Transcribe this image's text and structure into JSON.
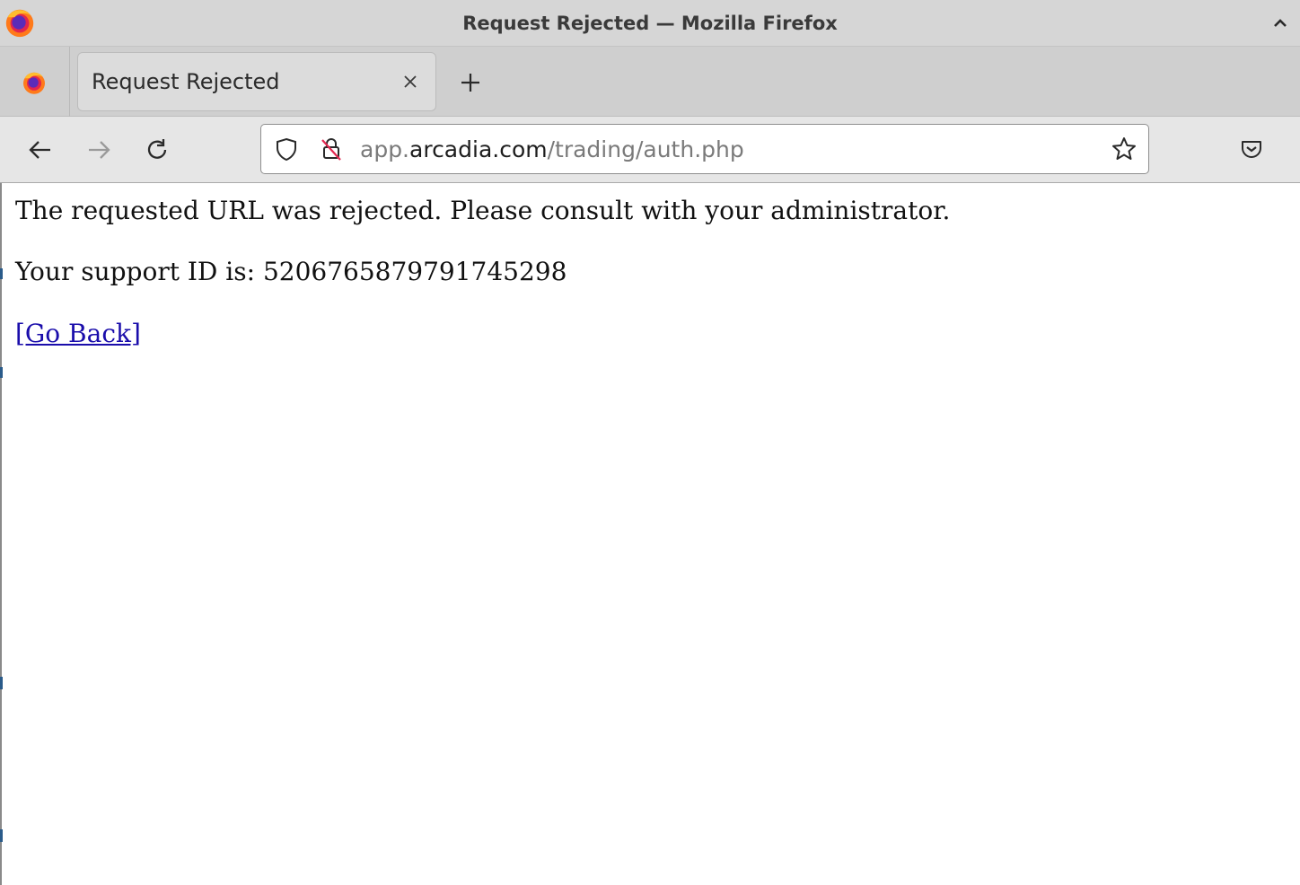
{
  "window": {
    "title": "Request Rejected — Mozilla Firefox"
  },
  "tabs": [
    {
      "label": "Request Rejected",
      "active": true
    }
  ],
  "toolbar": {
    "url": {
      "prefix": "app.",
      "domain": "arcadia.com",
      "path": "/trading/auth.php"
    }
  },
  "page": {
    "message": "The requested URL was rejected. Please consult with your administrator.",
    "support_label": "Your support ID is: ",
    "support_id": "5206765879791745298",
    "go_back": "[Go Back]"
  },
  "colors": {
    "link": "#1a0dab",
    "chrome": "#d6d6d6",
    "toolbar": "#e6e6e6"
  },
  "icons": [
    "firefox-logo-icon",
    "collapse-chevron-icon",
    "close-icon",
    "plus-icon",
    "back-arrow-icon",
    "forward-arrow-icon",
    "reload-icon",
    "shield-icon",
    "insecure-lock-icon",
    "star-icon",
    "pocket-icon"
  ]
}
